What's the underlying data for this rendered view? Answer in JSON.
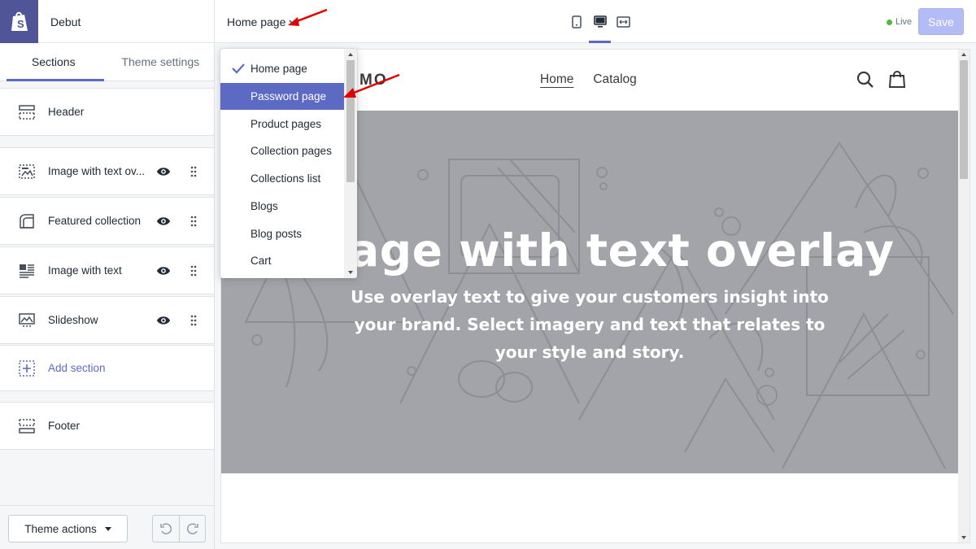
{
  "brand": {
    "theme_name": "Debut",
    "logo_icon": "shopify-bag-icon"
  },
  "topbar": {
    "page_selector": "Home page",
    "devices": [
      "mobile-icon",
      "desktop-icon",
      "fullscreen-icon"
    ],
    "active_device": "desktop",
    "live_label": "Live",
    "save_label": "Save",
    "colors": {
      "accent": "#5c6ac4",
      "live": "#50b83c",
      "save_disabled": "#b3bcf5"
    }
  },
  "sidebar": {
    "tabs": [
      {
        "label": "Sections",
        "active": true
      },
      {
        "label": "Theme settings",
        "active": false
      }
    ],
    "sections": [
      {
        "label": "Header",
        "icon": "header-icon"
      },
      {
        "label": "Image with text ov...",
        "icon": "image-overlay-icon"
      },
      {
        "label": "Featured collection",
        "icon": "collection-icon"
      },
      {
        "label": "Image with text",
        "icon": "image-text-icon"
      },
      {
        "label": "Slideshow",
        "icon": "slideshow-icon"
      },
      {
        "label": "Add section",
        "icon": "add-section-icon"
      },
      {
        "label": "Footer",
        "icon": "footer-icon"
      }
    ],
    "theme_actions_label": "Theme actions"
  },
  "dropdown": {
    "items": [
      {
        "label": "Home page",
        "selected": true
      },
      {
        "label": "Password page",
        "highlighted": true
      },
      {
        "label": "Product pages"
      },
      {
        "label": "Collection pages"
      },
      {
        "label": "Collections list"
      },
      {
        "label": "Blogs"
      },
      {
        "label": "Blog posts"
      },
      {
        "label": "Cart"
      }
    ]
  },
  "preview": {
    "store_logo": "MO",
    "nav": [
      "Home",
      "Catalog"
    ],
    "hero_title": "Image with text overlay",
    "hero_subtitle": "Use overlay text to give your customers insight into your brand. Select imagery and text that relates to your style and story."
  }
}
